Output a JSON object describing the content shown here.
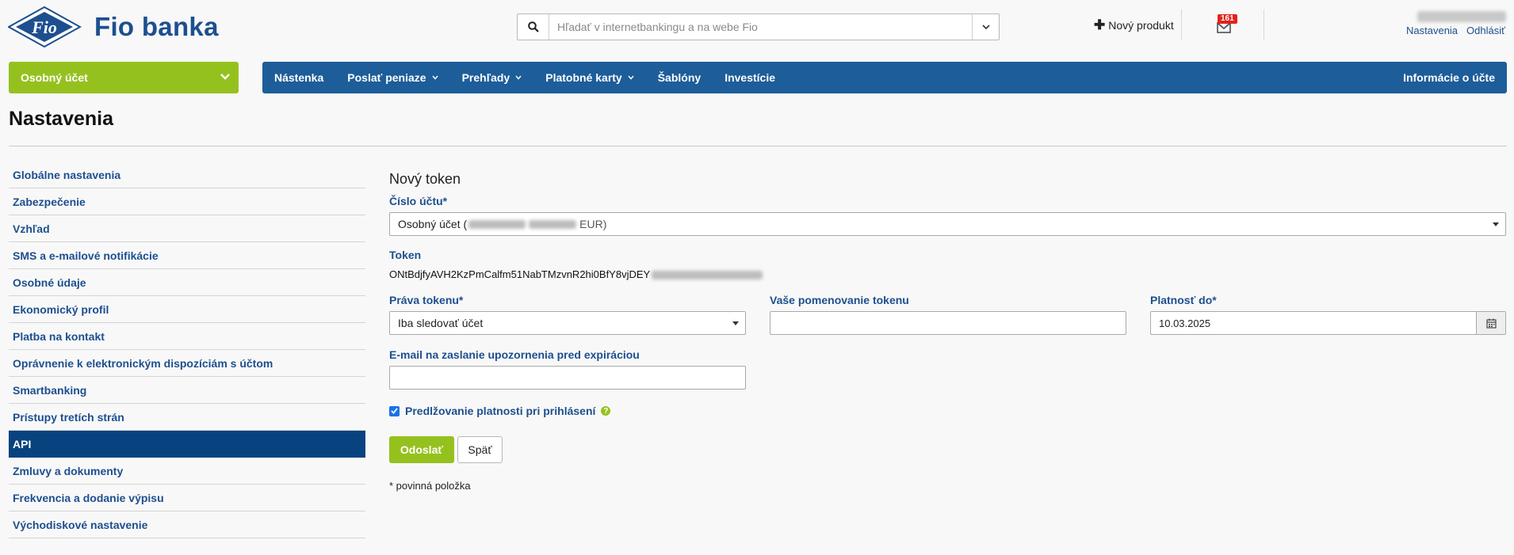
{
  "brand": {
    "name": "Fio banka",
    "logo_text": "Fio"
  },
  "search": {
    "placeholder": "Hľadať v internetbankingu a na webe Fio"
  },
  "header": {
    "new_product": "Nový produkt",
    "messages_count": "161",
    "links": {
      "settings": "Nastavenia",
      "logout": "Odhlásiť"
    }
  },
  "account_selector": {
    "label": "Osobný účet"
  },
  "nav": {
    "items": [
      {
        "label": "Nástenka"
      },
      {
        "label": "Poslať peniaze"
      },
      {
        "label": "Prehľady"
      },
      {
        "label": "Platobné karty"
      },
      {
        "label": "Šablóny"
      },
      {
        "label": "Investície"
      }
    ],
    "right": "Informácie o účte"
  },
  "page": {
    "title": "Nastavenia"
  },
  "sidebar": {
    "items": [
      {
        "label": "Globálne nastavenia"
      },
      {
        "label": "Zabezpečenie"
      },
      {
        "label": "Vzhľad"
      },
      {
        "label": "SMS a e-mailové notifikácie"
      },
      {
        "label": "Osobné údaje"
      },
      {
        "label": "Ekonomický profil"
      },
      {
        "label": "Platba na kontakt"
      },
      {
        "label": "Oprávnenie k elektronickým dispozíciám s účtom"
      },
      {
        "label": "Smartbanking"
      },
      {
        "label": "Prístupy tretích strán"
      },
      {
        "label": "API"
      },
      {
        "label": "Zmluvy a dokumenty"
      },
      {
        "label": "Frekvencia a dodanie výpisu"
      },
      {
        "label": "Východiskové nastavenie"
      }
    ]
  },
  "form": {
    "title": "Nový token",
    "account_label": "Číslo účtu*",
    "account_value_prefix": "Osobný účet (",
    "account_value_suffix": "EUR)",
    "token_label": "Token",
    "token_value": "ONtBdjfyAVH2KzPmCalfm51NabTMzvnR2hi0BfY8vjDEY",
    "rights_label": "Práva tokenu*",
    "rights_value": "Iba sledovať účet",
    "name_label": "Vaše pomenovanie tokenu",
    "name_value": "",
    "validity_label": "Platnosť do*",
    "validity_value": "10.03.2025",
    "email_label": "E-mail na zaslanie upozornenia pred expiráciou",
    "email_value": "",
    "extend_label": "Predlžovanie platnosti pri prihlásení",
    "extend_checked": true,
    "submit": "Odoslať",
    "back": "Späť",
    "required_note": "* povinná položka"
  },
  "colors": {
    "brand_blue": "#1d5d99",
    "accent_green": "#95c11f",
    "active_blue": "#08437f"
  }
}
